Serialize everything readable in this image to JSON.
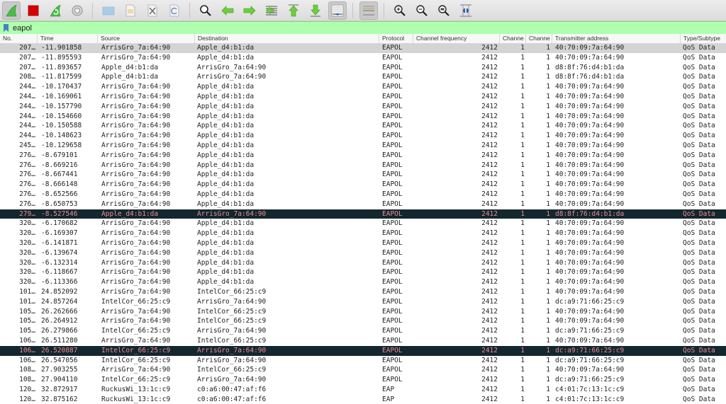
{
  "toolbar": {
    "buttons": [
      {
        "name": "start-capture",
        "icon": "shark-fin-icon"
      },
      {
        "name": "stop-capture",
        "icon": "stop-square-icon"
      },
      {
        "name": "restart-capture",
        "icon": "restart-fin-icon"
      },
      {
        "name": "capture-options",
        "icon": "gear-icon"
      },
      {
        "name": "open-file",
        "icon": "folder-icon"
      },
      {
        "name": "save-file",
        "icon": "file-icon"
      },
      {
        "name": "close-file",
        "icon": "close-file-icon"
      },
      {
        "name": "reload-file",
        "icon": "reload-icon"
      },
      {
        "name": "find-packet",
        "icon": "search-icon"
      },
      {
        "name": "go-back",
        "icon": "arrow-left-icon"
      },
      {
        "name": "go-forward",
        "icon": "arrow-right-icon"
      },
      {
        "name": "go-to-packet",
        "icon": "goto-packet-icon"
      },
      {
        "name": "go-first",
        "icon": "arrow-up-icon"
      },
      {
        "name": "go-last",
        "icon": "arrow-down-icon"
      },
      {
        "name": "autoscroll",
        "icon": "autoscroll-icon"
      },
      {
        "name": "colorize",
        "icon": "colorize-icon"
      },
      {
        "name": "zoom-in",
        "icon": "zoom-in-icon"
      },
      {
        "name": "zoom-out",
        "icon": "zoom-out-icon"
      },
      {
        "name": "zoom-normal",
        "icon": "zoom-reset-icon"
      },
      {
        "name": "resize-columns",
        "icon": "resize-columns-icon"
      }
    ]
  },
  "filter": {
    "value": "eapol",
    "bookmark_icon": "bookmark-icon",
    "color": "#afffaf"
  },
  "columns": [
    "No.",
    "Time",
    "Source",
    "Destination",
    "Protocol",
    "Channel frequency",
    "Channe",
    "Channe",
    "Transmitter address",
    "Type/Subtype"
  ],
  "colors": {
    "selected_row": "#d4d4d4",
    "marked_row_bg": "#12272e",
    "marked_row_fg": "#f08a96"
  },
  "packets": [
    {
      "no": "207…",
      "time": "-11.901858",
      "src": "ArrisGro_7a:64:90",
      "dst": "Apple_d4:b1:da",
      "proto": "EAPOL",
      "freq": "2412",
      "ch1": "1",
      "ch2": "1",
      "tx": "40:70:09:7a:64:90",
      "type": "QoS Data",
      "state": "selected"
    },
    {
      "no": "207…",
      "time": "-11.895593",
      "src": "ArrisGro_7a:64:90",
      "dst": "Apple_d4:b1:da",
      "proto": "EAPOL",
      "freq": "2412",
      "ch1": "1",
      "ch2": "1",
      "tx": "40:70:09:7a:64:90",
      "type": "QoS Data",
      "state": ""
    },
    {
      "no": "207…",
      "time": "-11.893657",
      "src": "Apple_d4:b1:da",
      "dst": "ArrisGro_7a:64:90",
      "proto": "EAPOL",
      "freq": "2412",
      "ch1": "1",
      "ch2": "1",
      "tx": "d8:8f:76:d4:b1:da",
      "type": "QoS Data",
      "state": ""
    },
    {
      "no": "208…",
      "time": "-11.817599",
      "src": "Apple_d4:b1:da",
      "dst": "ArrisGro_7a:64:90",
      "proto": "EAPOL",
      "freq": "2412",
      "ch1": "1",
      "ch2": "1",
      "tx": "d8:8f:76:d4:b1:da",
      "type": "QoS Data",
      "state": ""
    },
    {
      "no": "244…",
      "time": "-10.170437",
      "src": "ArrisGro_7a:64:90",
      "dst": "Apple_d4:b1:da",
      "proto": "EAPOL",
      "freq": "2412",
      "ch1": "1",
      "ch2": "1",
      "tx": "40:70:09:7a:64:90",
      "type": "QoS Data",
      "state": ""
    },
    {
      "no": "244…",
      "time": "-10.169061",
      "src": "ArrisGro_7a:64:90",
      "dst": "Apple_d4:b1:da",
      "proto": "EAPOL",
      "freq": "2412",
      "ch1": "1",
      "ch2": "1",
      "tx": "40:70:09:7a:64:90",
      "type": "QoS Data",
      "state": ""
    },
    {
      "no": "244…",
      "time": "-10.157790",
      "src": "ArrisGro_7a:64:90",
      "dst": "Apple_d4:b1:da",
      "proto": "EAPOL",
      "freq": "2412",
      "ch1": "1",
      "ch2": "1",
      "tx": "40:70:09:7a:64:90",
      "type": "QoS Data",
      "state": ""
    },
    {
      "no": "244…",
      "time": "-10.154660",
      "src": "ArrisGro_7a:64:90",
      "dst": "Apple_d4:b1:da",
      "proto": "EAPOL",
      "freq": "2412",
      "ch1": "1",
      "ch2": "1",
      "tx": "40:70:09:7a:64:90",
      "type": "QoS Data",
      "state": ""
    },
    {
      "no": "244…",
      "time": "-10.150588",
      "src": "ArrisGro_7a:64:90",
      "dst": "Apple_d4:b1:da",
      "proto": "EAPOL",
      "freq": "2412",
      "ch1": "1",
      "ch2": "1",
      "tx": "40:70:09:7a:64:90",
      "type": "QoS Data",
      "state": ""
    },
    {
      "no": "244…",
      "time": "-10.148623",
      "src": "ArrisGro_7a:64:90",
      "dst": "Apple_d4:b1:da",
      "proto": "EAPOL",
      "freq": "2412",
      "ch1": "1",
      "ch2": "1",
      "tx": "40:70:09:7a:64:90",
      "type": "QoS Data",
      "state": ""
    },
    {
      "no": "245…",
      "time": "-10.129658",
      "src": "ArrisGro_7a:64:90",
      "dst": "Apple_d4:b1:da",
      "proto": "EAPOL",
      "freq": "2412",
      "ch1": "1",
      "ch2": "1",
      "tx": "40:70:09:7a:64:90",
      "type": "QoS Data",
      "state": ""
    },
    {
      "no": "276…",
      "time": "-8.679101",
      "src": "ArrisGro_7a:64:90",
      "dst": "Apple_d4:b1:da",
      "proto": "EAPOL",
      "freq": "2412",
      "ch1": "1",
      "ch2": "1",
      "tx": "40:70:09:7a:64:90",
      "type": "QoS Data",
      "state": ""
    },
    {
      "no": "276…",
      "time": "-8.669216",
      "src": "ArrisGro_7a:64:90",
      "dst": "Apple_d4:b1:da",
      "proto": "EAPOL",
      "freq": "2412",
      "ch1": "1",
      "ch2": "1",
      "tx": "40:70:09:7a:64:90",
      "type": "QoS Data",
      "state": ""
    },
    {
      "no": "276…",
      "time": "-8.667441",
      "src": "ArrisGro_7a:64:90",
      "dst": "Apple_d4:b1:da",
      "proto": "EAPOL",
      "freq": "2412",
      "ch1": "1",
      "ch2": "1",
      "tx": "40:70:09:7a:64:90",
      "type": "QoS Data",
      "state": ""
    },
    {
      "no": "276…",
      "time": "-8.666148",
      "src": "ArrisGro_7a:64:90",
      "dst": "Apple_d4:b1:da",
      "proto": "EAPOL",
      "freq": "2412",
      "ch1": "1",
      "ch2": "1",
      "tx": "40:70:09:7a:64:90",
      "type": "QoS Data",
      "state": ""
    },
    {
      "no": "276…",
      "time": "-8.652566",
      "src": "ArrisGro_7a:64:90",
      "dst": "Apple_d4:b1:da",
      "proto": "EAPOL",
      "freq": "2412",
      "ch1": "1",
      "ch2": "1",
      "tx": "40:70:09:7a:64:90",
      "type": "QoS Data",
      "state": ""
    },
    {
      "no": "276…",
      "time": "-8.650753",
      "src": "ArrisGro_7a:64:90",
      "dst": "Apple_d4:b1:da",
      "proto": "EAPOL",
      "freq": "2412",
      "ch1": "1",
      "ch2": "1",
      "tx": "40:70:09:7a:64:90",
      "type": "QoS Data",
      "state": ""
    },
    {
      "no": "279…",
      "time": "-8.527546",
      "src": "Apple_d4:b1:da",
      "dst": "ArrisGro_7a:64:90",
      "proto": "EAPOL",
      "freq": "2412",
      "ch1": "1",
      "ch2": "1",
      "tx": "d8:8f:76:d4:b1:da",
      "type": "QoS Data",
      "state": "marked"
    },
    {
      "no": "320…",
      "time": "-6.170682",
      "src": "ArrisGro_7a:64:90",
      "dst": "Apple_d4:b1:da",
      "proto": "EAPOL",
      "freq": "2412",
      "ch1": "1",
      "ch2": "1",
      "tx": "40:70:09:7a:64:90",
      "type": "QoS Data",
      "state": ""
    },
    {
      "no": "320…",
      "time": "-6.169307",
      "src": "ArrisGro_7a:64:90",
      "dst": "Apple_d4:b1:da",
      "proto": "EAPOL",
      "freq": "2412",
      "ch1": "1",
      "ch2": "1",
      "tx": "40:70:09:7a:64:90",
      "type": "QoS Data",
      "state": ""
    },
    {
      "no": "320…",
      "time": "-6.141871",
      "src": "ArrisGro_7a:64:90",
      "dst": "Apple_d4:b1:da",
      "proto": "EAPOL",
      "freq": "2412",
      "ch1": "1",
      "ch2": "1",
      "tx": "40:70:09:7a:64:90",
      "type": "QoS Data",
      "state": ""
    },
    {
      "no": "320…",
      "time": "-6.139674",
      "src": "ArrisGro_7a:64:90",
      "dst": "Apple_d4:b1:da",
      "proto": "EAPOL",
      "freq": "2412",
      "ch1": "1",
      "ch2": "1",
      "tx": "40:70:09:7a:64:90",
      "type": "QoS Data",
      "state": ""
    },
    {
      "no": "320…",
      "time": "-6.132314",
      "src": "ArrisGro_7a:64:90",
      "dst": "Apple_d4:b1:da",
      "proto": "EAPOL",
      "freq": "2412",
      "ch1": "1",
      "ch2": "1",
      "tx": "40:70:09:7a:64:90",
      "type": "QoS Data",
      "state": ""
    },
    {
      "no": "320…",
      "time": "-6.118667",
      "src": "ArrisGro_7a:64:90",
      "dst": "Apple_d4:b1:da",
      "proto": "EAPOL",
      "freq": "2412",
      "ch1": "1",
      "ch2": "1",
      "tx": "40:70:09:7a:64:90",
      "type": "QoS Data",
      "state": ""
    },
    {
      "no": "320…",
      "time": "-6.113366",
      "src": "ArrisGro_7a:64:90",
      "dst": "Apple_d4:b1:da",
      "proto": "EAPOL",
      "freq": "2412",
      "ch1": "1",
      "ch2": "1",
      "tx": "40:70:09:7a:64:90",
      "type": "QoS Data",
      "state": ""
    },
    {
      "no": "101…",
      "time": "24.852092",
      "src": "ArrisGro_7a:64:90",
      "dst": "IntelCor_66:25:c9",
      "proto": "EAPOL",
      "freq": "2412",
      "ch1": "1",
      "ch2": "1",
      "tx": "40:70:09:7a:64:90",
      "type": "QoS Data",
      "state": ""
    },
    {
      "no": "101…",
      "time": "24.857264",
      "src": "IntelCor_66:25:c9",
      "dst": "ArrisGro_7a:64:90",
      "proto": "EAPOL",
      "freq": "2412",
      "ch1": "1",
      "ch2": "1",
      "tx": "dc:a9:71:66:25:c9",
      "type": "QoS Data",
      "state": ""
    },
    {
      "no": "105…",
      "time": "26.262666",
      "src": "ArrisGro_7a:64:90",
      "dst": "IntelCor_66:25:c9",
      "proto": "EAPOL",
      "freq": "2412",
      "ch1": "1",
      "ch2": "1",
      "tx": "40:70:09:7a:64:90",
      "type": "QoS Data",
      "state": ""
    },
    {
      "no": "105…",
      "time": "26.264912",
      "src": "ArrisGro_7a:64:90",
      "dst": "IntelCor_66:25:c9",
      "proto": "EAPOL",
      "freq": "2412",
      "ch1": "1",
      "ch2": "1",
      "tx": "40:70:09:7a:64:90",
      "type": "QoS Data",
      "state": ""
    },
    {
      "no": "105…",
      "time": "26.279866",
      "src": "IntelCor_66:25:c9",
      "dst": "ArrisGro_7a:64:90",
      "proto": "EAPOL",
      "freq": "2412",
      "ch1": "1",
      "ch2": "1",
      "tx": "dc:a9:71:66:25:c9",
      "type": "QoS Data",
      "state": ""
    },
    {
      "no": "106…",
      "time": "26.511280",
      "src": "ArrisGro_7a:64:90",
      "dst": "IntelCor_66:25:c9",
      "proto": "EAPOL",
      "freq": "2412",
      "ch1": "1",
      "ch2": "1",
      "tx": "40:70:09:7a:64:90",
      "type": "QoS Data",
      "state": ""
    },
    {
      "no": "106…",
      "time": "26.520887",
      "src": "IntelCor_66:25:c9",
      "dst": "ArrisGro_7a:64:90",
      "proto": "EAPOL",
      "freq": "2412",
      "ch1": "1",
      "ch2": "1",
      "tx": "dc:a9:71:66:25:c9",
      "type": "QoS Data",
      "state": "marked"
    },
    {
      "no": "106…",
      "time": "26.547056",
      "src": "IntelCor_66:25:c9",
      "dst": "ArrisGro_7a:64:90",
      "proto": "EAPOL",
      "freq": "2412",
      "ch1": "1",
      "ch2": "1",
      "tx": "dc:a9:71:66:25:c9",
      "type": "QoS Data",
      "state": ""
    },
    {
      "no": "108…",
      "time": "27.903255",
      "src": "ArrisGro_7a:64:90",
      "dst": "IntelCor_66:25:c9",
      "proto": "EAPOL",
      "freq": "2412",
      "ch1": "1",
      "ch2": "1",
      "tx": "40:70:09:7a:64:90",
      "type": "QoS Data",
      "state": ""
    },
    {
      "no": "108…",
      "time": "27.904110",
      "src": "IntelCor_66:25:c9",
      "dst": "ArrisGro_7a:64:90",
      "proto": "EAPOL",
      "freq": "2412",
      "ch1": "1",
      "ch2": "1",
      "tx": "dc:a9:71:66:25:c9",
      "type": "QoS Data",
      "state": ""
    },
    {
      "no": "120…",
      "time": "32.872917",
      "src": "RuckusWi_13:1c:c9",
      "dst": "c0:a6:00:47:af:f6",
      "proto": "EAP",
      "freq": "2412",
      "ch1": "1",
      "ch2": "1",
      "tx": "c4:01:7c:13:1c:c9",
      "type": "QoS Data",
      "state": ""
    },
    {
      "no": "120…",
      "time": "32.875162",
      "src": "RuckusWi_13:1c:c9",
      "dst": "c0:a6:00:47:af:f6",
      "proto": "EAP",
      "freq": "2412",
      "ch1": "1",
      "ch2": "1",
      "tx": "c4:01:7c:13:1c:c9",
      "type": "QoS Data",
      "state": ""
    }
  ]
}
